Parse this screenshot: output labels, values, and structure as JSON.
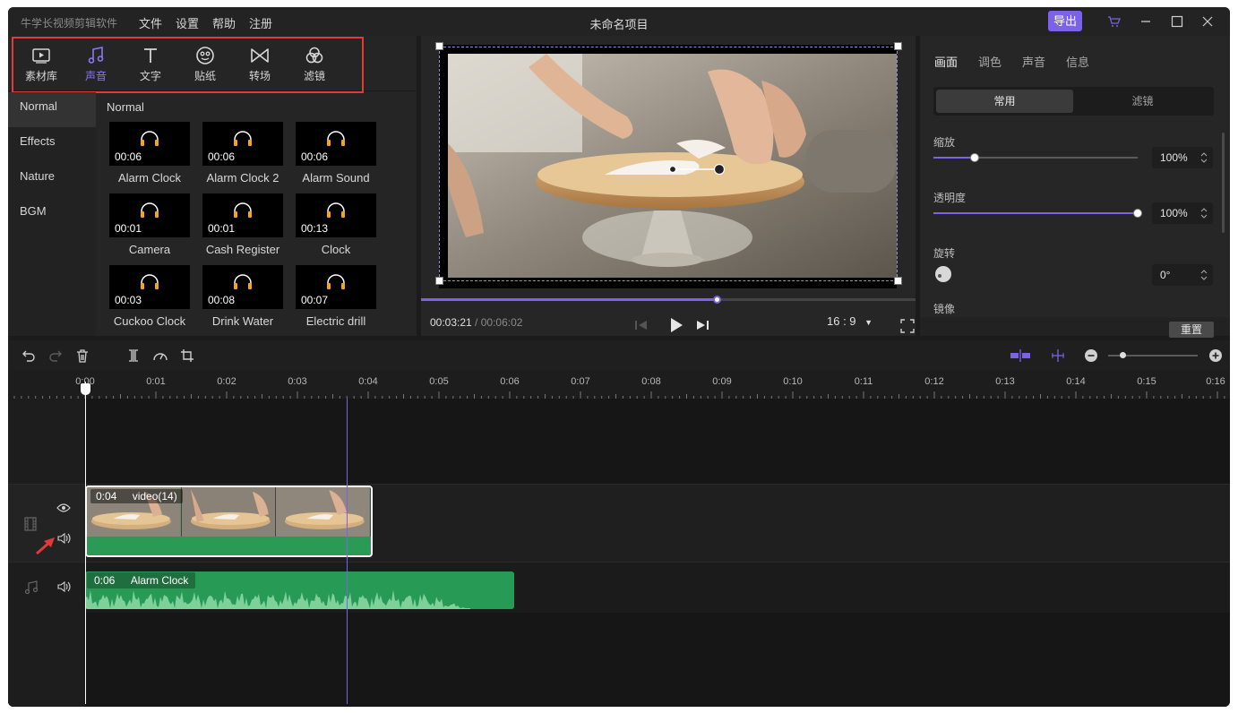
{
  "app": {
    "name": "牛学长视频剪辑软件",
    "menu": [
      "文件",
      "设置",
      "帮助",
      "注册"
    ],
    "project_title": "未命名项目",
    "export_label": "导出"
  },
  "media_tools": [
    {
      "label": "素材库",
      "icon": "media-library-icon",
      "active": false
    },
    {
      "label": "声音",
      "icon": "music-note-icon",
      "active": true
    },
    {
      "label": "文字",
      "icon": "text-icon",
      "active": false
    },
    {
      "label": "贴纸",
      "icon": "sticker-icon",
      "active": false
    },
    {
      "label": "转场",
      "icon": "transition-icon",
      "active": false
    },
    {
      "label": "滤镜",
      "icon": "filter-icon",
      "active": false
    }
  ],
  "categories": [
    {
      "label": "Normal",
      "active": true
    },
    {
      "label": "Effects",
      "active": false
    },
    {
      "label": "Nature",
      "active": false
    },
    {
      "label": "BGM",
      "active": false
    }
  ],
  "grid_title": "Normal",
  "sounds": [
    {
      "name": "Alarm Clock",
      "duration": "00:06"
    },
    {
      "name": "Alarm Clock 2",
      "duration": "00:06"
    },
    {
      "name": "Alarm Sound",
      "duration": "00:06"
    },
    {
      "name": "Camera",
      "duration": "00:01"
    },
    {
      "name": "Cash Register",
      "duration": "00:01"
    },
    {
      "name": "Clock",
      "duration": "00:13"
    },
    {
      "name": "Cuckoo Clock",
      "duration": "00:03"
    },
    {
      "name": "Drink Water",
      "duration": "00:08"
    },
    {
      "name": "Electric drill",
      "duration": "00:07"
    }
  ],
  "preview": {
    "current_time": "00:03:21",
    "separator": " / ",
    "total_time": "00:06:02",
    "progress": 0.6,
    "aspect_ratio": "16 : 9"
  },
  "properties": {
    "tabs": [
      "画面",
      "调色",
      "声音",
      "信息"
    ],
    "active_tab": 0,
    "segments": [
      "常用",
      "滤镜"
    ],
    "scale_label": "缩放",
    "scale_value": "100%",
    "scale_level": 0.2,
    "opacity_label": "透明度",
    "opacity_value": "100%",
    "opacity_level": 1.0,
    "rotate_label": "旋转",
    "rotate_value": "0°",
    "mirror_label": "镜像",
    "reset_label": "重置"
  },
  "timeline": {
    "ticks": [
      "0:00",
      "0:01",
      "0:02",
      "0:03",
      "0:04",
      "0:05",
      "0:06",
      "0:07",
      "0:08",
      "0:09",
      "0:10",
      "0:11",
      "0:12",
      "0:13",
      "0:14",
      "0:15",
      "0:16"
    ],
    "video_clip": {
      "duration": "0:04",
      "name": "video(14)"
    },
    "audio_clip": {
      "duration": "0:06",
      "name": "Alarm Clock"
    }
  },
  "colors": {
    "accent": "#7b62e8",
    "audio_green": "#279b55",
    "annotation_red": "#e23a3a"
  }
}
